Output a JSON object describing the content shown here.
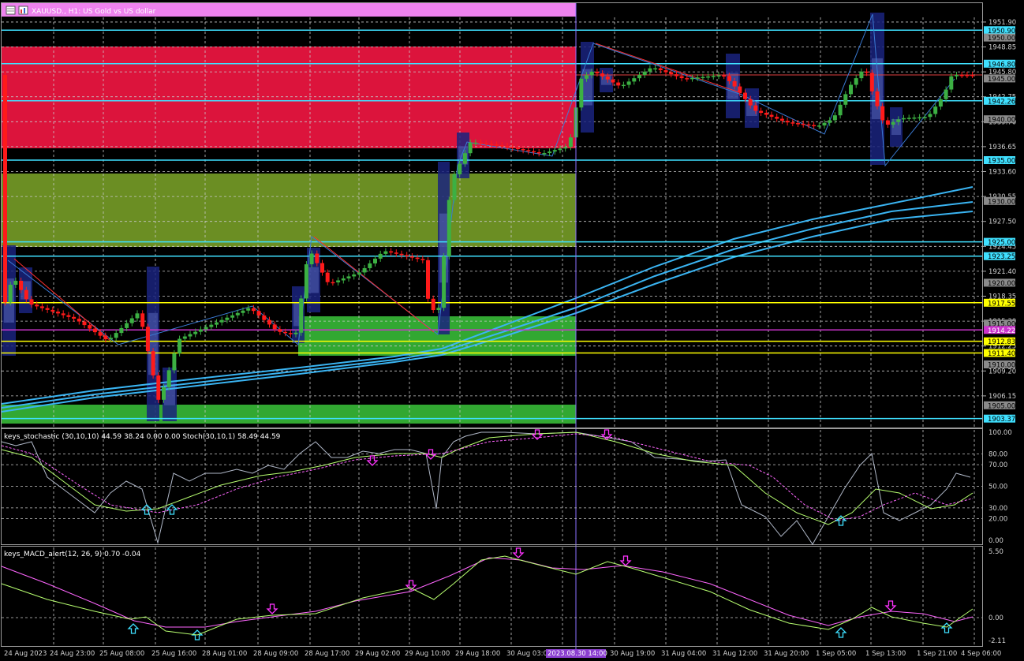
{
  "window": {
    "title": "XAUUSD., H1: US Gold vs US dollar",
    "colors": {
      "background": "#000000",
      "title_bar": "#ee82ee",
      "bull": "#3cb043",
      "bear": "#ff1a1a",
      "level_cyan": "#3fe0ff",
      "level_yellow": "#ffff00",
      "level_magenta": "#cc33cc",
      "zone_red": "#dc143c",
      "zone_olive": "#6b8e23",
      "zone_green": "#32a832",
      "ma": "#3ab4f2"
    }
  },
  "price_axis": {
    "ticks": [
      "1951.90",
      "1948.85",
      "1945.80",
      "1942.75",
      "1939.70",
      "1936.65",
      "1933.60",
      "1930.55",
      "1927.50",
      "1924.45",
      "1921.40",
      "1918.35",
      "1915.30",
      "1912.25",
      "1909.20",
      "1906.15"
    ],
    "tags": [
      {
        "text": "1950.90",
        "kind": "cyan"
      },
      {
        "text": "1950.00",
        "kind": "gray"
      },
      {
        "text": "1946.80",
        "kind": "cyan"
      },
      {
        "text": "1945.00",
        "kind": "gray"
      },
      {
        "text": "1942.26",
        "kind": "cyan"
      },
      {
        "text": "1940.00",
        "kind": "gray"
      },
      {
        "text": "1935.00",
        "kind": "cyan"
      },
      {
        "text": "1930.00",
        "kind": "gray"
      },
      {
        "text": "1925.00",
        "kind": "cyan"
      },
      {
        "text": "1923.25",
        "kind": "cyan"
      },
      {
        "text": "1920.00",
        "kind": "gray"
      },
      {
        "text": "1917.55",
        "kind": "yellow"
      },
      {
        "text": "1915.00",
        "kind": "gray"
      },
      {
        "text": "1914.22",
        "kind": "magenta"
      },
      {
        "text": "1912.83",
        "kind": "yellow"
      },
      {
        "text": "1911.40",
        "kind": "yellow"
      },
      {
        "text": "1910.00",
        "kind": "gray"
      },
      {
        "text": "1905.00",
        "kind": "gray"
      },
      {
        "text": "1903.37",
        "kind": "cyan"
      }
    ]
  },
  "stochastic": {
    "title": "keys_stochastic (30,10,10) 44.59 38.24 0.00 0.00 Stoch(30,10,1) 58.49 44.59",
    "levels": [
      "100.00",
      "80.00",
      "70.00",
      "50.00",
      "30.00",
      "20.00",
      "0.00"
    ]
  },
  "macd": {
    "title": "keys_MACD_alert(12, 26, 9) 0.70 -0.04",
    "levels": [
      "5.50",
      "0.00",
      "-2.11"
    ]
  },
  "time_axis": {
    "labels": [
      "24 Aug 2023",
      "24 Aug 23:00",
      "25 Aug 08:00",
      "25 Aug 16:00",
      "28 Aug 01:00",
      "28 Aug 09:00",
      "28 Aug 17:00",
      "29 Aug 02:00",
      "29 Aug 10:00",
      "29 Aug 18:00",
      "30 Aug 03:00",
      "30 Aug 19:00",
      "31 Aug 04:00",
      "31 Aug 12:00",
      "31 Aug 20:00",
      "1 Sep 05:00",
      "1 Sep 13:00",
      "1 Sep 21:00",
      "4 Sep 06:00"
    ],
    "crosshair_label": "2023.08.30 14:00"
  }
}
